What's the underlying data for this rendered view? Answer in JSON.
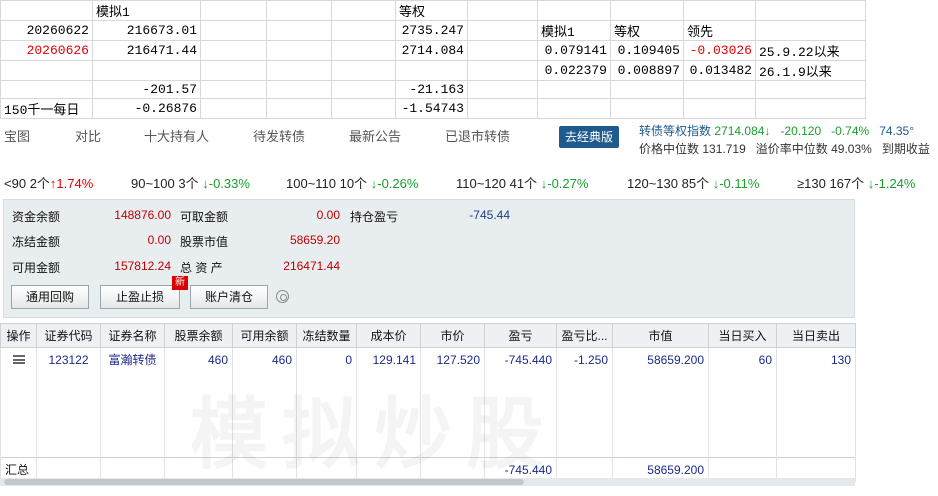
{
  "sheet": {
    "r1": {
      "c1": "",
      "c2": "模拟1",
      "c3": "",
      "c4": "",
      "c5": "",
      "c6": "等权",
      "c7": "",
      "c8": "",
      "c9": "",
      "c10": "",
      "c11": ""
    },
    "r2": {
      "c1": "20260622",
      "c2": "216673.01",
      "c6": "2735.247",
      "c8": "模拟1",
      "c9": "等权",
      "c10": "领先",
      "c11": ""
    },
    "r3": {
      "c1": "20260626",
      "c2": "216471.44",
      "c6": "2714.084",
      "c8": "0.079141",
      "c9": "0.109405",
      "c10": "-0.03026",
      "c11": "25.9.22以来"
    },
    "r4": {
      "c8": "0.022379",
      "c9": "0.008897",
      "c10": "0.013482",
      "c11": "26.1.9以来"
    },
    "r5": {
      "c2": "-201.57",
      "c6": "-21.163"
    },
    "r6": {
      "c1": "150千一每日",
      "c2": "-0.26876",
      "c6": "-1.54743"
    }
  },
  "nav": {
    "tabs": [
      "宝图",
      "对比",
      "十大持有人",
      "待发转债",
      "最新公告",
      "已退市转债"
    ],
    "classic_btn": "去经典版"
  },
  "index": {
    "name": "转债等权指数",
    "value": "2714.084",
    "arrow": "↓",
    "change": "-20.120",
    "pct": "-0.74%",
    "extra": "74.35°",
    "median_price_label": "价格中位数",
    "median_price": "131.719",
    "premium_label": "溢价率中位数",
    "premium": "49.03%",
    "due_label": "到期收益"
  },
  "ranges": [
    {
      "label": "<90",
      "count": "2个",
      "arrow": "↑",
      "pct": "1.74%",
      "dir": "up"
    },
    {
      "label": "90~100",
      "count": "3个",
      "arrow": "↓",
      "pct": "-0.33%",
      "dir": "down"
    },
    {
      "label": "100~110",
      "count": "10个",
      "arrow": "↓",
      "pct": "-0.26%",
      "dir": "down"
    },
    {
      "label": "110~120",
      "count": "41个",
      "arrow": "↓",
      "pct": "-0.27%",
      "dir": "down"
    },
    {
      "label": "120~130",
      "count": "85个",
      "arrow": "↓",
      "pct": "-0.11%",
      "dir": "down"
    },
    {
      "label": "≥130",
      "count": "167个",
      "arrow": "↓",
      "pct": "-1.24%",
      "dir": "down"
    }
  ],
  "account": {
    "fund_balance_label": "资金余额",
    "fund_balance": "148876.00",
    "withdrawable_label": "可取金额",
    "withdrawable": "0.00",
    "position_pl_label": "持仓盈亏",
    "position_pl": "-745.44",
    "frozen_label": "冻结金额",
    "frozen": "0.00",
    "stock_value_label": "股票市值",
    "stock_value": "58659.20",
    "available_label": "可用金额",
    "available": "157812.24",
    "total_assets_label": "总 资 产",
    "total_assets": "216471.44"
  },
  "buttons": {
    "repo": "通用回购",
    "stop": "止盈止损",
    "new_badge": "新",
    "clear": "账户清仓"
  },
  "table": {
    "headers": [
      "操作",
      "证券代码",
      "证券名称",
      "股票余额",
      "可用余额",
      "冻结数量",
      "成本价",
      "市价",
      "盈亏",
      "盈亏比...",
      "市值",
      "当日买入",
      "当日卖出"
    ],
    "rows": [
      {
        "code": "123122",
        "name": "富瀚转债",
        "balance": "460",
        "available": "460",
        "frozen": "0",
        "cost": "129.141",
        "price": "127.520",
        "pl": "-745.440",
        "pl_ratio": "-1.250",
        "value": "58659.200",
        "buy": "60",
        "sell": "130"
      }
    ],
    "summary": {
      "label": "汇总",
      "pl": "-745.440",
      "value": "58659.200"
    }
  },
  "watermark": "模拟炒股"
}
